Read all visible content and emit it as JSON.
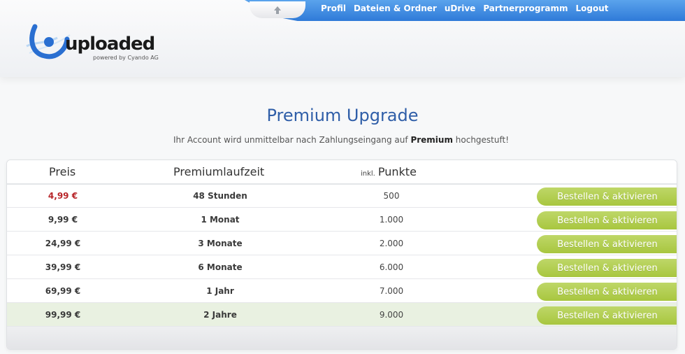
{
  "nav": {
    "items": [
      "Profil",
      "Dateien & Ordner",
      "uDrive",
      "Partnerprogramm",
      "Logout"
    ]
  },
  "logo": {
    "text": "uploaded",
    "sub": "powered by Cyando AG"
  },
  "page": {
    "title": "Premium Upgrade",
    "subtitle_pre": "Ihr Account wird unmittelbar nach Zahlungseingang auf ",
    "subtitle_bold": "Premium",
    "subtitle_post": " hochgestuft!"
  },
  "table": {
    "headers": {
      "price": "Preis",
      "duration": "Premiumlaufzeit",
      "points_prefix": "inkl.",
      "points": "Punkte"
    },
    "rows": [
      {
        "price": "4,99 €",
        "duration": "48 Stunden",
        "points": "500",
        "button": "Bestellen & aktivieren"
      },
      {
        "price": "9,99 €",
        "duration": "1 Monat",
        "points": "1.000",
        "button": "Bestellen & aktivieren"
      },
      {
        "price": "24,99 €",
        "duration": "3 Monate",
        "points": "2.000",
        "button": "Bestellen & aktivieren"
      },
      {
        "price": "39,99 €",
        "duration": "6 Monate",
        "points": "6.000",
        "button": "Bestellen & aktivieren"
      },
      {
        "price": "69,99 €",
        "duration": "1 Jahr",
        "points": "7.000",
        "button": "Bestellen & aktivieren"
      },
      {
        "price": "99,99 €",
        "duration": "2 Jahre",
        "points": "9.000",
        "button": "Bestellen & aktivieren"
      }
    ]
  },
  "colors": {
    "accent": "#2f5ea8",
    "button": "#b3cf52",
    "nav": "#3d89e0",
    "price_highlight": "#b8262a"
  }
}
